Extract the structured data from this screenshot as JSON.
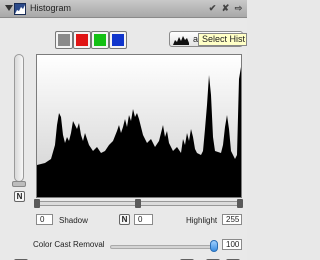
{
  "window": {
    "title": "Histogram",
    "buttons": [
      "✔",
      "✘",
      "⇨"
    ]
  },
  "channels": [
    {
      "name": "gray",
      "color": "#888888"
    },
    {
      "name": "red",
      "color": "#dd1111"
    },
    {
      "name": "green",
      "color": "#11bb11"
    },
    {
      "name": "blue",
      "color": "#1133cc"
    }
  ],
  "mode_select": {
    "value": "additive"
  },
  "tooltip": {
    "text": "Select Hist"
  },
  "controls": {
    "n_label": "N",
    "shadow_value": "0",
    "shadow_label": "Shadow",
    "mid_value": "0",
    "highlight_label": "Highlight",
    "highlight_value": "255",
    "color_cast_label": "Color Cast Removal",
    "color_cast_value": "100"
  },
  "bottom": {
    "help_glyph": "?"
  },
  "colors": {
    "histogram_fill": "#000000",
    "histogram_bg_light": "#ffffff",
    "histogram_bg_dark": "#cfcfcf"
  }
}
